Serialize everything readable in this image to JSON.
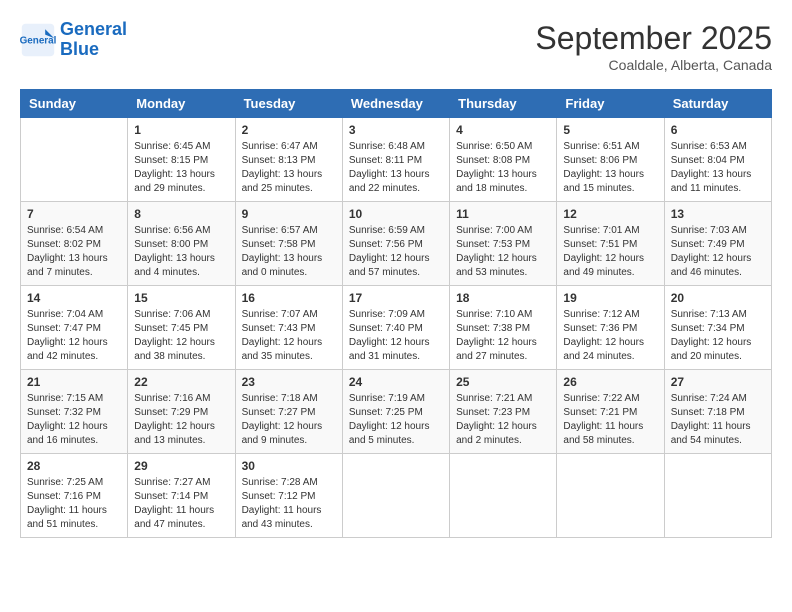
{
  "logo": {
    "line1": "General",
    "line2": "Blue"
  },
  "title": "September 2025",
  "subtitle": "Coaldale, Alberta, Canada",
  "days_of_week": [
    "Sunday",
    "Monday",
    "Tuesday",
    "Wednesday",
    "Thursday",
    "Friday",
    "Saturday"
  ],
  "weeks": [
    [
      {
        "day": "",
        "content": ""
      },
      {
        "day": "1",
        "content": "Sunrise: 6:45 AM\nSunset: 8:15 PM\nDaylight: 13 hours\nand 29 minutes."
      },
      {
        "day": "2",
        "content": "Sunrise: 6:47 AM\nSunset: 8:13 PM\nDaylight: 13 hours\nand 25 minutes."
      },
      {
        "day": "3",
        "content": "Sunrise: 6:48 AM\nSunset: 8:11 PM\nDaylight: 13 hours\nand 22 minutes."
      },
      {
        "day": "4",
        "content": "Sunrise: 6:50 AM\nSunset: 8:08 PM\nDaylight: 13 hours\nand 18 minutes."
      },
      {
        "day": "5",
        "content": "Sunrise: 6:51 AM\nSunset: 8:06 PM\nDaylight: 13 hours\nand 15 minutes."
      },
      {
        "day": "6",
        "content": "Sunrise: 6:53 AM\nSunset: 8:04 PM\nDaylight: 13 hours\nand 11 minutes."
      }
    ],
    [
      {
        "day": "7",
        "content": "Sunrise: 6:54 AM\nSunset: 8:02 PM\nDaylight: 13 hours\nand 7 minutes."
      },
      {
        "day": "8",
        "content": "Sunrise: 6:56 AM\nSunset: 8:00 PM\nDaylight: 13 hours\nand 4 minutes."
      },
      {
        "day": "9",
        "content": "Sunrise: 6:57 AM\nSunset: 7:58 PM\nDaylight: 13 hours\nand 0 minutes."
      },
      {
        "day": "10",
        "content": "Sunrise: 6:59 AM\nSunset: 7:56 PM\nDaylight: 12 hours\nand 57 minutes."
      },
      {
        "day": "11",
        "content": "Sunrise: 7:00 AM\nSunset: 7:53 PM\nDaylight: 12 hours\nand 53 minutes."
      },
      {
        "day": "12",
        "content": "Sunrise: 7:01 AM\nSunset: 7:51 PM\nDaylight: 12 hours\nand 49 minutes."
      },
      {
        "day": "13",
        "content": "Sunrise: 7:03 AM\nSunset: 7:49 PM\nDaylight: 12 hours\nand 46 minutes."
      }
    ],
    [
      {
        "day": "14",
        "content": "Sunrise: 7:04 AM\nSunset: 7:47 PM\nDaylight: 12 hours\nand 42 minutes."
      },
      {
        "day": "15",
        "content": "Sunrise: 7:06 AM\nSunset: 7:45 PM\nDaylight: 12 hours\nand 38 minutes."
      },
      {
        "day": "16",
        "content": "Sunrise: 7:07 AM\nSunset: 7:43 PM\nDaylight: 12 hours\nand 35 minutes."
      },
      {
        "day": "17",
        "content": "Sunrise: 7:09 AM\nSunset: 7:40 PM\nDaylight: 12 hours\nand 31 minutes."
      },
      {
        "day": "18",
        "content": "Sunrise: 7:10 AM\nSunset: 7:38 PM\nDaylight: 12 hours\nand 27 minutes."
      },
      {
        "day": "19",
        "content": "Sunrise: 7:12 AM\nSunset: 7:36 PM\nDaylight: 12 hours\nand 24 minutes."
      },
      {
        "day": "20",
        "content": "Sunrise: 7:13 AM\nSunset: 7:34 PM\nDaylight: 12 hours\nand 20 minutes."
      }
    ],
    [
      {
        "day": "21",
        "content": "Sunrise: 7:15 AM\nSunset: 7:32 PM\nDaylight: 12 hours\nand 16 minutes."
      },
      {
        "day": "22",
        "content": "Sunrise: 7:16 AM\nSunset: 7:29 PM\nDaylight: 12 hours\nand 13 minutes."
      },
      {
        "day": "23",
        "content": "Sunrise: 7:18 AM\nSunset: 7:27 PM\nDaylight: 12 hours\nand 9 minutes."
      },
      {
        "day": "24",
        "content": "Sunrise: 7:19 AM\nSunset: 7:25 PM\nDaylight: 12 hours\nand 5 minutes."
      },
      {
        "day": "25",
        "content": "Sunrise: 7:21 AM\nSunset: 7:23 PM\nDaylight: 12 hours\nand 2 minutes."
      },
      {
        "day": "26",
        "content": "Sunrise: 7:22 AM\nSunset: 7:21 PM\nDaylight: 11 hours\nand 58 minutes."
      },
      {
        "day": "27",
        "content": "Sunrise: 7:24 AM\nSunset: 7:18 PM\nDaylight: 11 hours\nand 54 minutes."
      }
    ],
    [
      {
        "day": "28",
        "content": "Sunrise: 7:25 AM\nSunset: 7:16 PM\nDaylight: 11 hours\nand 51 minutes."
      },
      {
        "day": "29",
        "content": "Sunrise: 7:27 AM\nSunset: 7:14 PM\nDaylight: 11 hours\nand 47 minutes."
      },
      {
        "day": "30",
        "content": "Sunrise: 7:28 AM\nSunset: 7:12 PM\nDaylight: 11 hours\nand 43 minutes."
      },
      {
        "day": "",
        "content": ""
      },
      {
        "day": "",
        "content": ""
      },
      {
        "day": "",
        "content": ""
      },
      {
        "day": "",
        "content": ""
      }
    ]
  ]
}
